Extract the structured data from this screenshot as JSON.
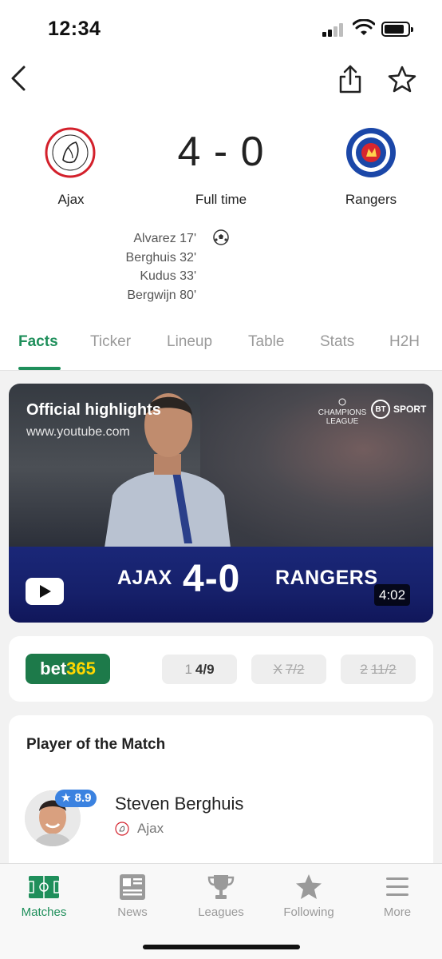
{
  "status_bar": {
    "time": "12:34"
  },
  "match": {
    "home": {
      "name": "Ajax"
    },
    "away": {
      "name": "Rangers"
    },
    "score": "4 - 0",
    "status": "Full time",
    "home_scorers": [
      "Alvarez 17'",
      "Berghuis 32'",
      "Kudus 33'",
      "Bergwijn 80'"
    ]
  },
  "tabs": [
    {
      "label": "Facts",
      "active": true
    },
    {
      "label": "Ticker"
    },
    {
      "label": "Lineup"
    },
    {
      "label": "Table"
    },
    {
      "label": "Stats"
    },
    {
      "label": "H2H"
    }
  ],
  "video": {
    "title": "Official highlights",
    "source": "www.youtube.com",
    "competition_logo_text": "CHAMPIONS LEAGUE",
    "broadcaster_logo_text": "SPORT",
    "broadcaster_badge": "BT",
    "banner_home": "AJAX",
    "banner_score": "4-0",
    "banner_away": "RANGERS",
    "duration": "4:02"
  },
  "odds": {
    "bookmaker_prefix": "bet",
    "bookmaker_suffix": "365",
    "home": {
      "label": "1",
      "value": "4/9"
    },
    "draw": {
      "label": "X",
      "value": "7/2"
    },
    "away": {
      "label": "2",
      "value": "11/2"
    }
  },
  "player_of_match": {
    "title": "Player of the Match",
    "rating": "8.9",
    "name": "Steven Berghuis",
    "team": "Ajax"
  },
  "bottom_nav": [
    {
      "label": "Matches",
      "icon": "pitch-icon",
      "active": true
    },
    {
      "label": "News",
      "icon": "news-icon"
    },
    {
      "label": "Leagues",
      "icon": "trophy-icon"
    },
    {
      "label": "Following",
      "icon": "star-icon"
    },
    {
      "label": "More",
      "icon": "menu-icon"
    }
  ],
  "colors": {
    "accent": "#1f8f5b",
    "rating_badge": "#3b82e0",
    "bet365_green": "#1d7a4a",
    "bet365_yellow": "#ffd700"
  }
}
